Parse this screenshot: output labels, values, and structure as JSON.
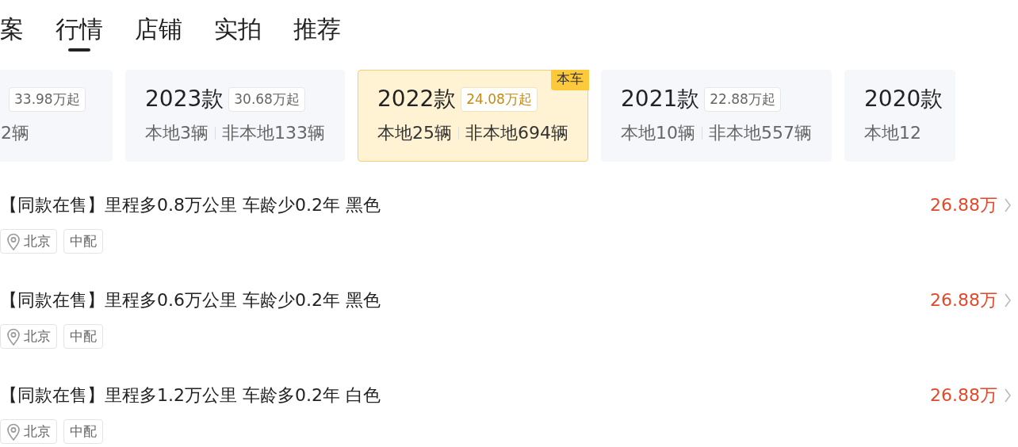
{
  "tabs": [
    {
      "label": "案",
      "selected": false
    },
    {
      "label": "行情",
      "selected": true
    },
    {
      "label": "店铺",
      "selected": false
    },
    {
      "label": "实拍",
      "selected": false
    },
    {
      "label": "推荐",
      "selected": false
    }
  ],
  "models": [
    {
      "price": "33.98万起",
      "local": "2辆",
      "selected": false
    },
    {
      "year": "2023款",
      "price": "30.68万起",
      "local": "本地3辆",
      "nonlocal": "非本地133辆",
      "selected": false
    },
    {
      "year": "2022款",
      "price": "24.08万起",
      "local": "本地25辆",
      "nonlocal": "非本地694辆",
      "selected": true,
      "badge": "本车"
    },
    {
      "year": "2021款",
      "price": "22.88万起",
      "local": "本地10辆",
      "nonlocal": "非本地557辆",
      "selected": false
    },
    {
      "year": "2020款",
      "local": "本地12",
      "selected": false
    }
  ],
  "listings": [
    {
      "title": "【同款在售】里程多0.8万公里 车龄少0.2年 黑色",
      "city": "北京",
      "trim": "中配",
      "price": "26.88万"
    },
    {
      "title": "【同款在售】里程多0.6万公里 车龄少0.2年 黑色",
      "city": "北京",
      "trim": "中配",
      "price": "26.88万"
    },
    {
      "title": "【同款在售】里程多1.2万公里 车龄多0.2年 白色",
      "city": "北京",
      "trim": "中配",
      "price": "26.88万"
    }
  ]
}
